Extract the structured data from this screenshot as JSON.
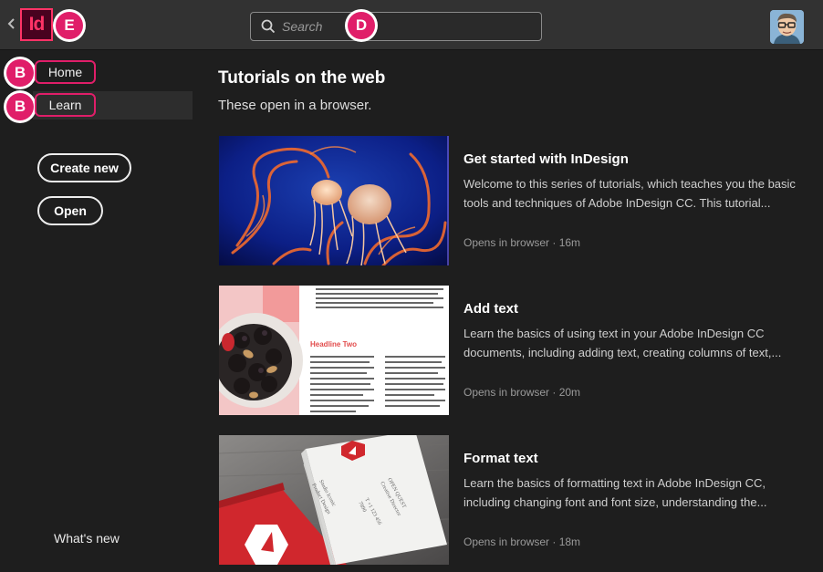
{
  "app": {
    "logo_text": "Id",
    "callouts": {
      "logo": "E",
      "search": "D",
      "home": "B",
      "learn": "B"
    }
  },
  "search": {
    "placeholder": "Search"
  },
  "sidebar": {
    "items": [
      {
        "label": "Home"
      },
      {
        "label": "Learn"
      }
    ],
    "create_new_label": "Create new",
    "open_label": "Open",
    "whats_new_label": "What's new"
  },
  "main": {
    "title": "Tutorials on the web",
    "subtitle": "These open in a browser.",
    "tutorials": [
      {
        "title": "Get started with InDesign",
        "description": "Welcome to this series of tutorials, which teaches you the basic tools and techniques of Adobe InDesign CC. This tutorial...",
        "meta": "Opens in browser · 16m"
      },
      {
        "title": "Add text",
        "description": "Learn the basics of using text in your Adobe InDesign CC documents, including adding text, creating columns of text,...",
        "meta": "Opens in browser · 20m"
      },
      {
        "title": "Format text",
        "description": "Learn the basics of formatting text in Adobe InDesign CC, including changing font and font size, understanding the...",
        "meta": "Opens in browser · 18m"
      }
    ],
    "thumb2_headline": "Headline Two"
  },
  "colors": {
    "accent": "#e01e69",
    "indesign_brand": "#ff3366",
    "background": "#1e1e1e",
    "topbar": "#323232"
  },
  "icons": [
    "back-chevron-icon",
    "indesign-logo-icon",
    "search-icon",
    "user-avatar"
  ]
}
